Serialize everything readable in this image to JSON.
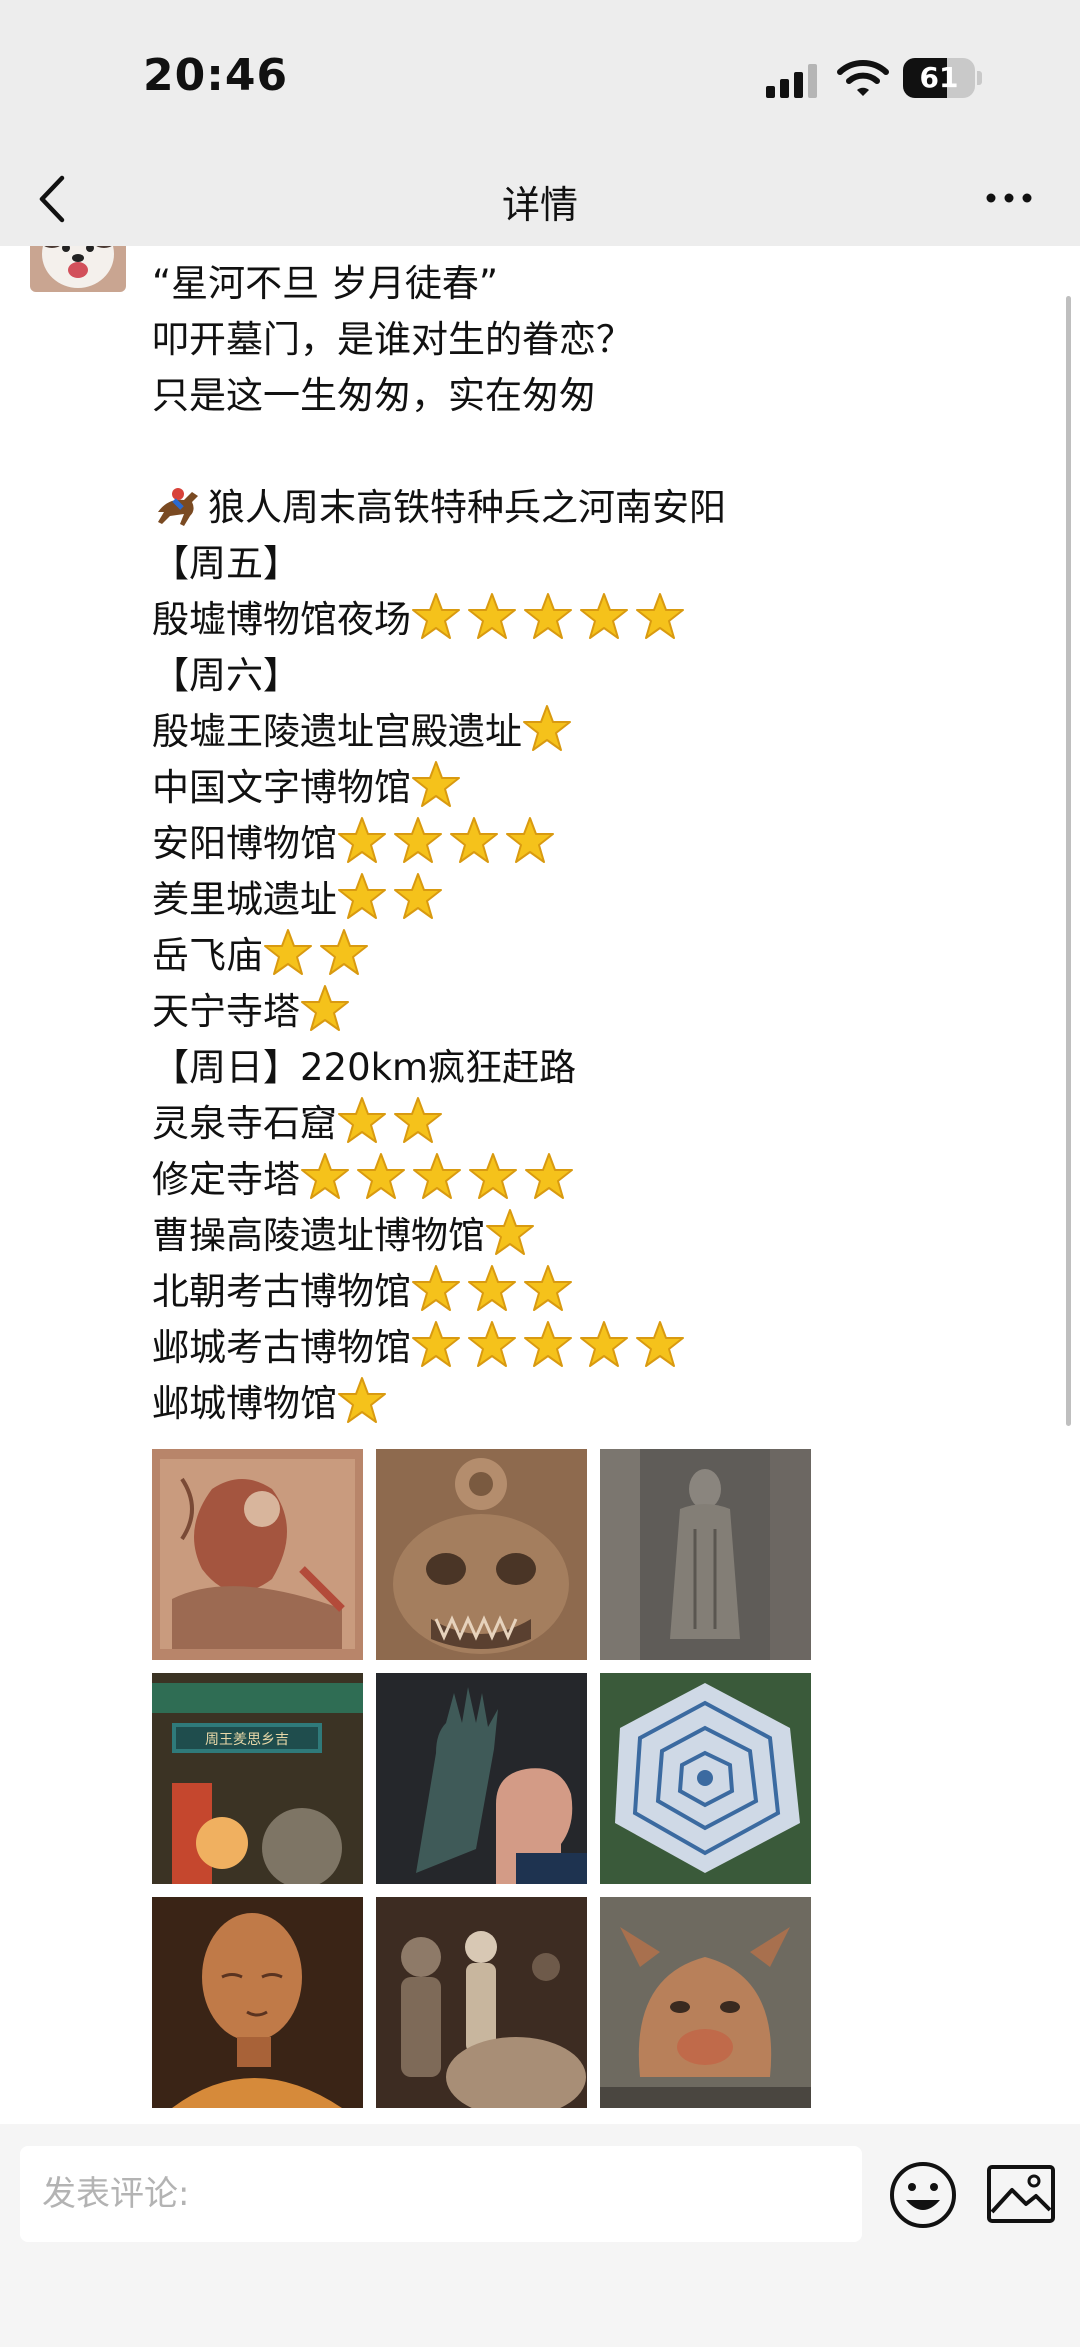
{
  "status_bar": {
    "time": "20:46",
    "battery_level": "61"
  },
  "nav": {
    "title": "详情"
  },
  "post": {
    "lines": [
      "“星河不旦 岁月徒春”",
      "叩开墓门，是谁对生的眷恋？",
      "只是这一生匆匆，实在匆匆",
      "",
      "狼人周末高铁特种兵之河南安阳",
      "【周五】",
      "殷墟博物馆夜场",
      "【周六】",
      "殷墟王陵遗址宫殿遗址",
      "中国文字博物馆",
      "安阳博物馆",
      "羑里城遗址",
      "岳飞庙",
      "天宁寺塔",
      "【周日】220km疯狂赶路",
      "灵泉寺石窟",
      "修定寺塔",
      "曹操高陵遗址博物馆",
      "北朝考古博物馆",
      "邺城考古博物馆",
      "邺城博物馆"
    ],
    "stars": [
      0,
      0,
      0,
      0,
      0,
      0,
      5,
      0,
      1,
      1,
      4,
      2,
      2,
      1,
      0,
      2,
      5,
      1,
      3,
      5,
      1
    ],
    "lead_icon": "horse-racing-icon",
    "photos": [
      "relief-carving-photo",
      "beast-face-carving-photo",
      "stone-buddha-statue-photo",
      "temple-gate-plaque-photo",
      "bronze-hand-and-fist-photo",
      "maze-aerial-photo",
      "clay-figurine-head-photo",
      "pottery-figurines-photo",
      "pig-head-artifact-photo"
    ]
  },
  "comment": {
    "placeholder": "发表评论:"
  },
  "colors": {
    "star": "#f5c21b",
    "page_bg": "#ededed",
    "bar_bg": "#f5f5f5"
  }
}
